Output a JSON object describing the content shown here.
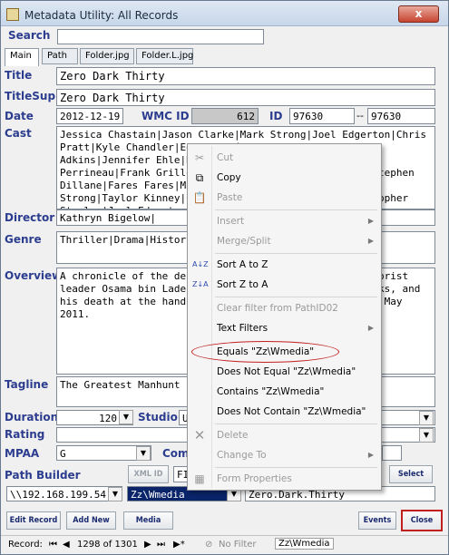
{
  "window": {
    "title": "Metadata Utility: All Records",
    "close_label": "x"
  },
  "labels": {
    "search": "Search",
    "title": "Title",
    "title_supp": "TitleSupp",
    "date": "Date",
    "wmc_id": "WMC ID",
    "id": "ID",
    "cast": "Cast",
    "director": "Director",
    "genre": "Genre",
    "overview": "Overview",
    "tagline": "Tagline",
    "duration": "Duration",
    "studio": "Studio",
    "rating": "Rating",
    "mpaa": "MPAA",
    "com": "Com",
    "path_builder": "Path Builder"
  },
  "tabs": [
    "Main",
    "Path",
    "Folder.jpg",
    "Folder.L.jpg"
  ],
  "fields": {
    "search": "",
    "title": "Zero Dark Thirty",
    "title_supp": "Zero Dark Thirty",
    "date": "2012-12-19",
    "wmc_id": "612",
    "id": "97630",
    "id_dash": "--",
    "id2": "97630",
    "cast": "Jessica Chastain|Jason Clarke|Mark Strong|Joel Edgerton|Chris Pratt|Kyle Chandler|Edgar Ramírez|Mark Duplass|Scott Adkins|Jennifer Ehle|Ricky Sekhon|Reda Kateb|Harold Perrineau|Frank Grillo|J.J. Kandel|James Gandolfini|Stephen Dillane|Fares Fares|Mark Valley|Fredric Lehne|Jeremy Strong|Taylor Kinney|Chris Pratt|Callan Mulvey|Christopher Stanley|Joel Edgerton|Delaney|John Barrowman",
    "director": "Kathryn Bigelow|",
    "genre": "Thriller|Drama|History|",
    "overview": "A chronicle of the decade-long hunt for al-Qaeda terrorist leader Osama bin Laden after the September 2001 attacks, and his death at the hands of the Navy S.E.A.L. Team 6 in May 2011.",
    "tagline": "The Greatest Manhunt in History",
    "duration": "120",
    "studio": "U",
    "mpaa": "G",
    "path_xml": "XML ID",
    "path_fi": "FI",
    "path_root": "\\\\192.168.199.54",
    "path_folder": "Zz\\Wmedia",
    "path_name": "Zero.Dark.Thirty"
  },
  "buttons": {
    "edit_record": "Edit Record",
    "add_new": "Add New",
    "media": "Media",
    "events": "Events",
    "close": "Close",
    "select": "Select",
    "xml_id": "XML ID"
  },
  "context_menu": {
    "cut": "Cut",
    "copy": "Copy",
    "paste": "Paste",
    "insert": "Insert",
    "merge_split": "Merge/Split",
    "sort_az": "Sort A to Z",
    "sort_za": "Sort Z to A",
    "clear_filter": "Clear filter from PathID02",
    "text_filters": "Text Filters",
    "equals": "Equals \"Zz\\Wmedia\"",
    "not_equal": "Does Not Equal \"Zz\\Wmedia\"",
    "contains": "Contains \"Zz\\Wmedia\"",
    "not_contain": "Does Not Contain \"Zz\\Wmedia\"",
    "delete": "Delete",
    "change_to": "Change To",
    "form_props": "Form Properties"
  },
  "status": {
    "record_label": "Record:",
    "record_pos": "1298 of 1301",
    "filter": "No Filter",
    "search_value": "Zz\\Wmedia"
  },
  "colors": {
    "label": "#2c3d8f",
    "highlight": "#c21f1f",
    "wmc_bg": "#c8c8c8"
  }
}
